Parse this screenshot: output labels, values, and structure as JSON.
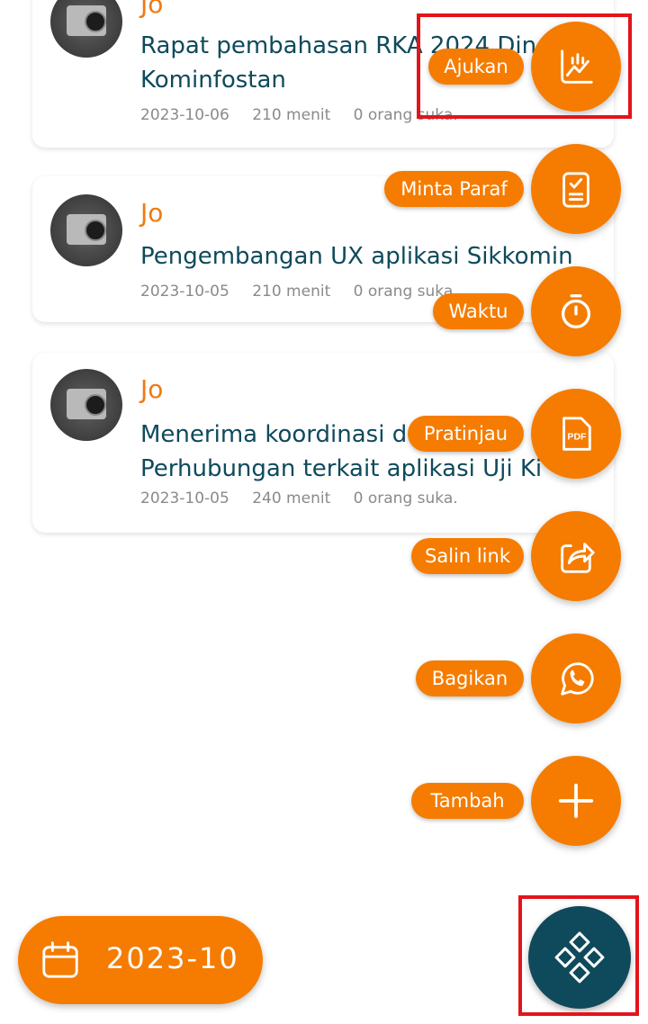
{
  "posts": [
    {
      "author": "Jo",
      "title_line1": "Rapat pembahasan RKA 2024 Din",
      "title_line2": "Kominfostan",
      "date": "2023-10-06",
      "duration": "210 menit",
      "likes": "0 orang suka."
    },
    {
      "author": "Jo",
      "title_line1": "Pengembangan UX aplikasi Sikkomin",
      "date": "2023-10-05",
      "duration": "210 menit",
      "likes": "0 orang suka."
    },
    {
      "author": "Jo",
      "title_line1": "Menerima koordinasi d",
      "title_line2": "Perhubungan terkait aplikasi Uji Ki",
      "date": "2023-10-05",
      "duration": "240 menit",
      "likes": "0 orang suka."
    }
  ],
  "actions": [
    {
      "label": "Ajukan",
      "icon": "chart-report-icon"
    },
    {
      "label": "Minta Paraf",
      "icon": "clipboard-check-icon"
    },
    {
      "label": "Waktu",
      "icon": "stopwatch-icon"
    },
    {
      "label": "Pratinjau",
      "icon": "pdf-icon",
      "icon_text": "PDF"
    },
    {
      "label": "Salin link",
      "icon": "share-icon"
    },
    {
      "label": "Bagikan",
      "icon": "whatsapp-icon"
    },
    {
      "label": "Tambah",
      "icon": "plus-icon"
    }
  ],
  "period": "2023-10",
  "colors": {
    "accent": "#F57C00",
    "primary_dark": "#0F4A5C",
    "title_text": "#0E4A5C",
    "highlight": "#E3141B"
  }
}
